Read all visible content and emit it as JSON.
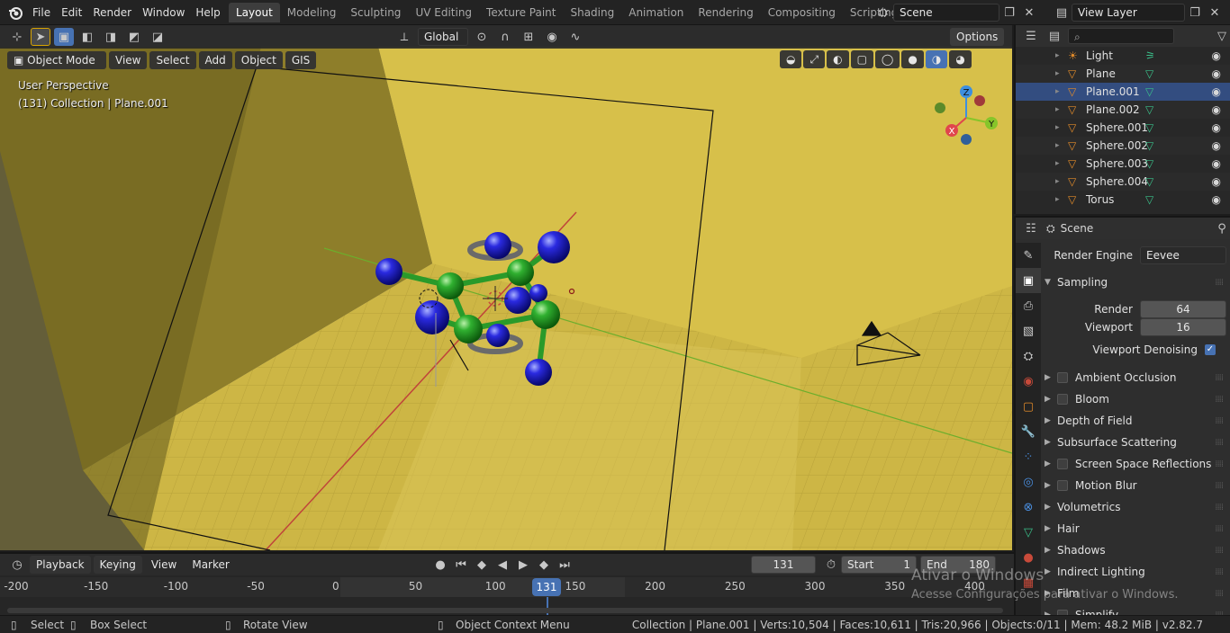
{
  "menu": [
    "File",
    "Edit",
    "Render",
    "Window",
    "Help"
  ],
  "workspaces": [
    "Layout",
    "Modeling",
    "Sculpting",
    "UV Editing",
    "Texture Paint",
    "Shading",
    "Animation",
    "Rendering",
    "Compositing",
    "Scripting"
  ],
  "active_workspace": "Layout",
  "scene_name": "Scene",
  "view_layer": "View Layer",
  "viewport": {
    "transform_orientation": "Global",
    "options_label": "Options",
    "mode": "Object Mode",
    "header_menus": [
      "View",
      "Select",
      "Add",
      "Object",
      "GIS"
    ],
    "perspective": "User Perspective",
    "collection_info": "(131) Collection | Plane.001",
    "gizmo_axes": {
      "x": "X",
      "y": "Y",
      "z": "Z"
    }
  },
  "outliner": {
    "search_placeholder": "",
    "items": [
      {
        "name": "Light",
        "type": "light"
      },
      {
        "name": "Plane",
        "type": "mesh"
      },
      {
        "name": "Plane.001",
        "type": "mesh",
        "selected": true
      },
      {
        "name": "Plane.002",
        "type": "mesh"
      },
      {
        "name": "Sphere.001",
        "type": "mesh"
      },
      {
        "name": "Sphere.002",
        "type": "mesh"
      },
      {
        "name": "Sphere.003",
        "type": "mesh"
      },
      {
        "name": "Sphere.004",
        "type": "mesh"
      },
      {
        "name": "Torus",
        "type": "mesh"
      }
    ]
  },
  "properties": {
    "context": "Scene",
    "render_engine_label": "Render Engine",
    "render_engine_value": "Eevee",
    "sampling": {
      "title": "Sampling",
      "render_label": "Render",
      "render_value": "64",
      "viewport_label": "Viewport",
      "viewport_value": "16",
      "denoise_label": "Viewport Denoising",
      "denoise_checked": true
    },
    "panels": [
      {
        "label": "Ambient Occlusion",
        "checkbox": true
      },
      {
        "label": "Bloom",
        "checkbox": true
      },
      {
        "label": "Depth of Field",
        "checkbox": false
      },
      {
        "label": "Subsurface Scattering",
        "checkbox": false
      },
      {
        "label": "Screen Space Reflections",
        "checkbox": true
      },
      {
        "label": "Motion Blur",
        "checkbox": true
      },
      {
        "label": "Volumetrics",
        "checkbox": false
      },
      {
        "label": "Hair",
        "checkbox": false
      },
      {
        "label": "Shadows",
        "checkbox": false
      },
      {
        "label": "Indirect Lighting",
        "checkbox": false
      },
      {
        "label": "Film",
        "checkbox": false
      },
      {
        "label": "Simplify",
        "checkbox": true
      }
    ]
  },
  "timeline": {
    "menus": [
      "Playback",
      "Keying",
      "View",
      "Marker"
    ],
    "current_frame": "131",
    "start_label": "Start",
    "start_value": "1",
    "end_label": "End",
    "end_value": "180",
    "ruler_ticks": [
      "-200",
      "-150",
      "-100",
      "-50",
      "0",
      "50",
      "100",
      "150",
      "200",
      "250",
      "300",
      "350",
      "400"
    ]
  },
  "statusbar": {
    "select": "Select",
    "box_select": "Box Select",
    "rotate_view": "Rotate View",
    "context_menu": "Object Context Menu",
    "stats": "Collection | Plane.001 | Verts:10,504 | Faces:10,611 | Tris:20,966 | Objects:0/11 | Mem: 48.2 MiB | v2.82.7"
  },
  "watermark": {
    "line1": "Ativar o Windows",
    "line2": "Acesse Configurações para ativar o Windows."
  },
  "colors": {
    "accent_blue": "#4772b3",
    "floor_yellow": "#d4bd47",
    "wall_dark": "#8a7a28",
    "sphere_blue": "#1818c8",
    "sphere_green": "#2aa82a",
    "x_axis": "#e0454c",
    "y_axis": "#86c52a",
    "z_axis": "#3d8fe0"
  }
}
